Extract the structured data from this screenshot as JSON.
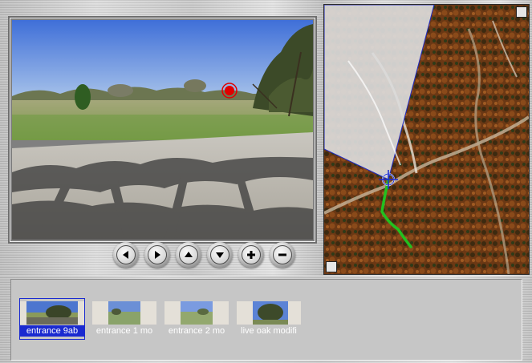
{
  "viewer": {
    "controls": [
      {
        "name": "pan-left-button",
        "icon": "arrow-left-icon"
      },
      {
        "name": "pan-right-button",
        "icon": "arrow-right-icon"
      },
      {
        "name": "tilt-up-button",
        "icon": "arrow-up-icon"
      },
      {
        "name": "tilt-down-button",
        "icon": "arrow-down-icon"
      },
      {
        "name": "zoom-in-button",
        "icon": "plus-icon"
      },
      {
        "name": "zoom-out-button",
        "icon": "minus-icon"
      }
    ],
    "hotspot_color": "#e00000"
  },
  "map": {
    "trail_color": "#22c020",
    "view_cone_color": "#dcdcdc",
    "cursor_icon": "crosshair-target-icon"
  },
  "thumbnails": [
    {
      "label": "entrance 9ab",
      "selected": true
    },
    {
      "label": "entrance 1 mo",
      "selected": false
    },
    {
      "label": "entrance 2 mo",
      "selected": false
    },
    {
      "label": "live oak modifi",
      "selected": false
    }
  ],
  "colors": {
    "selection": "#1a2ad0",
    "frame": "#c8c8c8"
  }
}
